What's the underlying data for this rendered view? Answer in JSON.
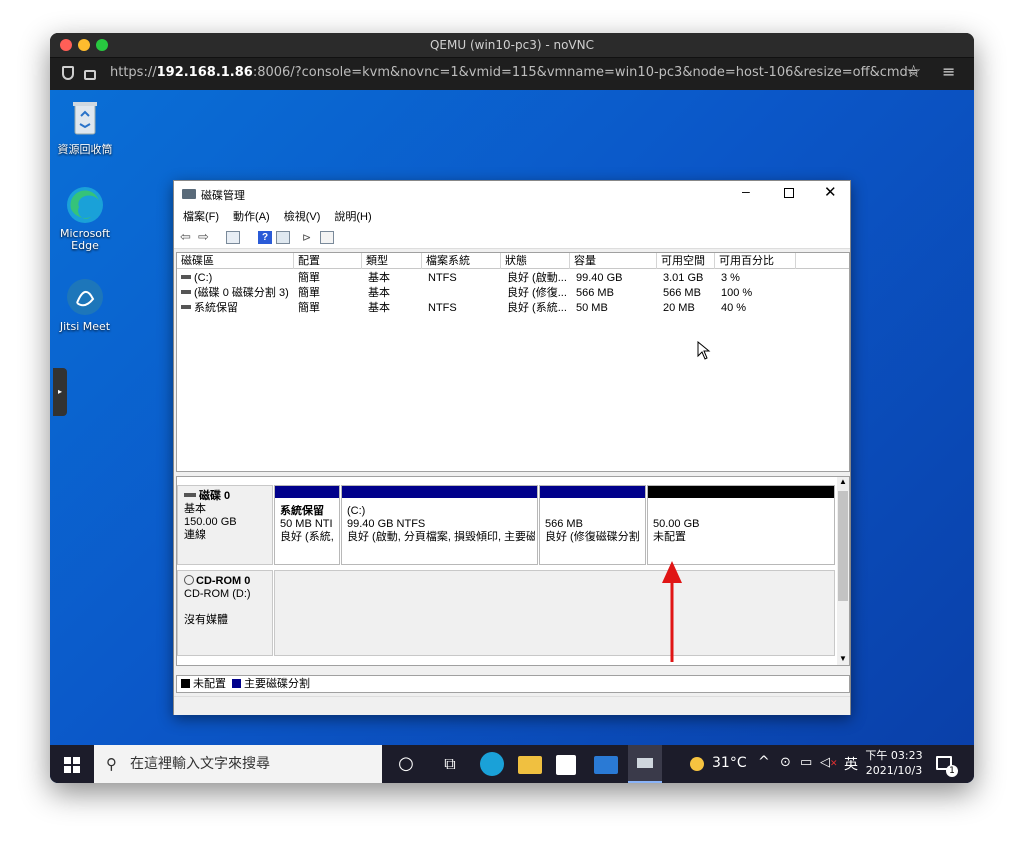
{
  "browser": {
    "title": "QEMU (win10-pc3) - noVNC",
    "url_prefix": "https://",
    "url_host": "192.168.1.86",
    "url_rest": ":8006/?console=kvm&novnc=1&vmid=115&vmname=win10-pc3&node=host-106&resize=off&cmd="
  },
  "desktop": {
    "icons": [
      "資源回收筒",
      "Microsoft\nEdge",
      "Jitsi Meet"
    ]
  },
  "disk_management": {
    "title": "磁碟管理",
    "menu": [
      "檔案(F)",
      "動作(A)",
      "檢視(V)",
      "說明(H)"
    ],
    "columns": [
      "磁碟區",
      "配置",
      "類型",
      "檔案系統",
      "狀態",
      "容量",
      "可用空間",
      "可用百分比"
    ],
    "volumes": [
      {
        "name": "(C:)",
        "layout": "簡單",
        "type": "基本",
        "fs": "NTFS",
        "status": "良好 (啟動...",
        "capacity": "99.40 GB",
        "free": "3.01 GB",
        "pct": "3 %"
      },
      {
        "name": "(磁碟 0 磁碟分割 3)",
        "layout": "簡單",
        "type": "基本",
        "fs": "",
        "status": "良好 (修復...",
        "capacity": "566 MB",
        "free": "566 MB",
        "pct": "100 %"
      },
      {
        "name": "系統保留",
        "layout": "簡單",
        "type": "基本",
        "fs": "NTFS",
        "status": "良好 (系統...",
        "capacity": "50 MB",
        "free": "20 MB",
        "pct": "40 %"
      }
    ],
    "disk0": {
      "name": "磁碟 0",
      "type": "基本",
      "size": "150.00 GB",
      "state": "連線",
      "partitions": [
        {
          "title": "系統保留",
          "line1": "50 MB NTI",
          "line2": "良好 (系統,"
        },
        {
          "title": "(C:)",
          "line1": "99.40 GB NTFS",
          "line2": "良好 (啟動, 分頁檔案, 損毀傾印, 主要磁"
        },
        {
          "title": "",
          "line1": "566 MB",
          "line2": "良好 (修復磁碟分割"
        },
        {
          "title": "",
          "line1": "50.00 GB",
          "line2": "未配置"
        }
      ]
    },
    "cdrom": {
      "name": "CD-ROM 0",
      "line1": "CD-ROM (D:)",
      "line2": "沒有媒體"
    },
    "legend": {
      "unallocated": "未配置",
      "primary": "主要磁碟分割"
    }
  },
  "taskbar": {
    "search_placeholder": "在這裡輸入文字來搜尋",
    "weather": "31°C",
    "ime": "英",
    "time": "下午 03:23",
    "date": "2021/10/3",
    "notification_count": "1"
  },
  "colors": {
    "primary_bar": "#00008b",
    "unallocated_bar": "#000000",
    "arrow": "#e01515"
  }
}
